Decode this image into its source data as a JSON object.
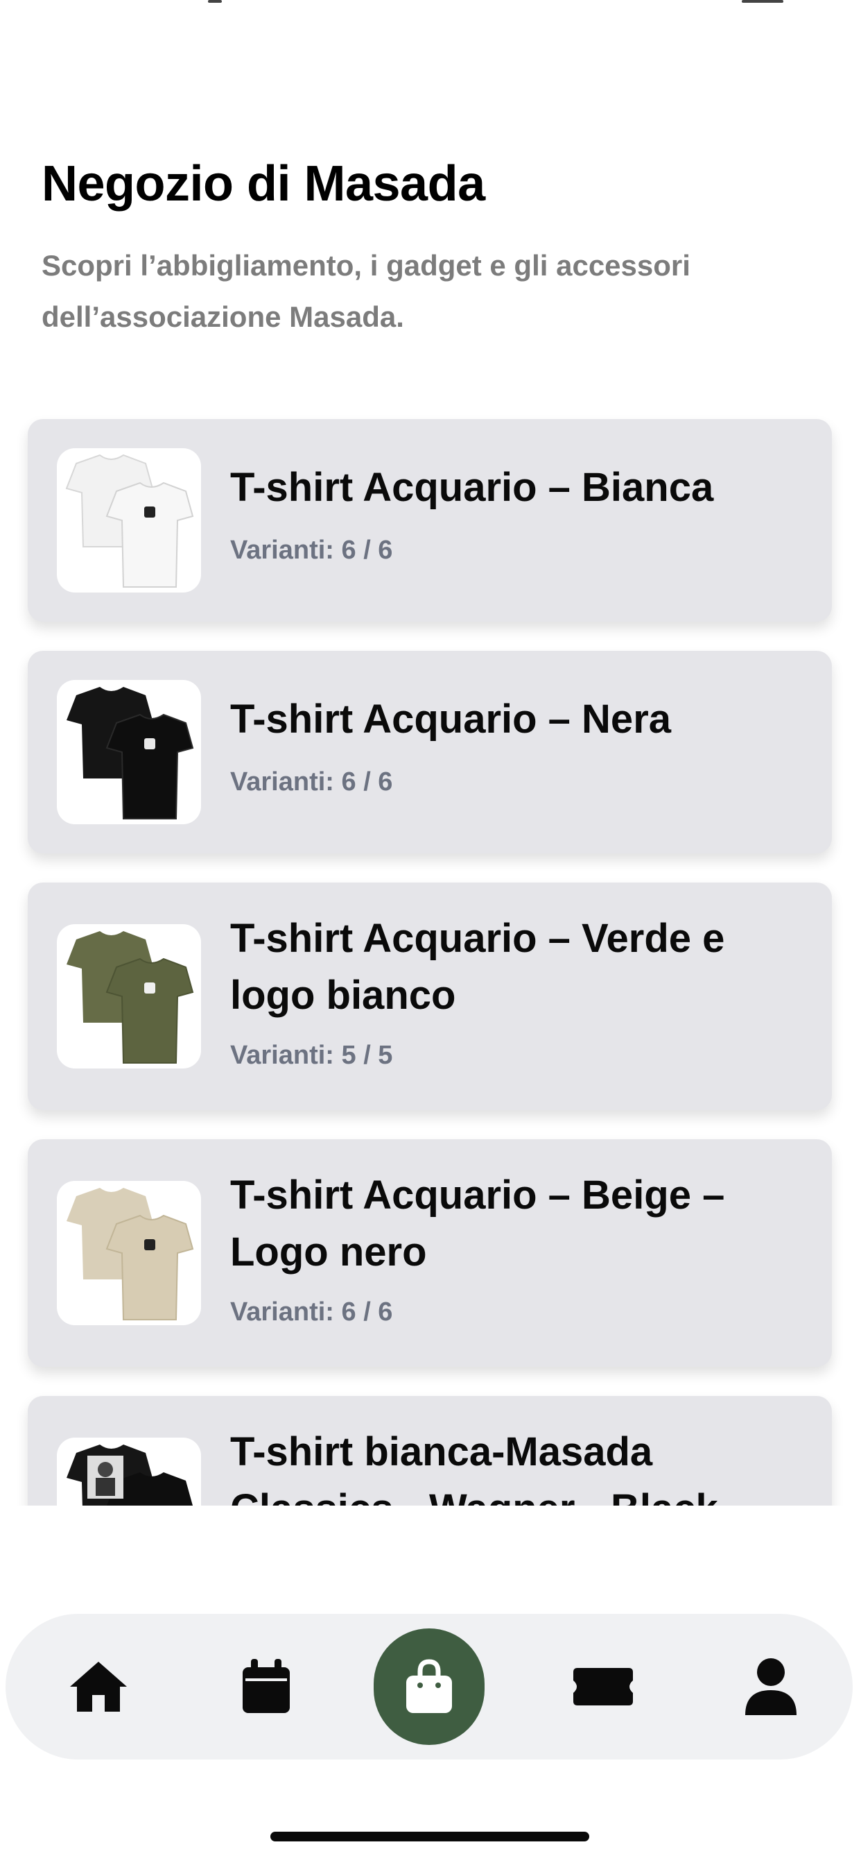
{
  "page": {
    "title": "Negozio di Masada",
    "subtitle": "Scopri l’abbigliamento, i gadget e gli accessori dell’associazione Masada."
  },
  "products": [
    {
      "name": "T-shirt Acquario – Bianca",
      "variants": "Varianti: 6 / 6",
      "shirt_color": "#f7f7f7",
      "logo_color": "#222222",
      "thumb_icon": "white-tshirt-thumbnail"
    },
    {
      "name": "T-shirt Acquario – Nera",
      "variants": "Varianti: 6 / 6",
      "shirt_color": "#111111",
      "logo_color": "#e9e9e9",
      "thumb_icon": "black-tshirt-thumbnail"
    },
    {
      "name": "T-shirt Acquario – Verde e logo bianco",
      "variants": "Varianti: 5 / 5",
      "shirt_color": "#5d6440",
      "logo_color": "#f0f0f0",
      "thumb_icon": "green-tshirt-thumbnail"
    },
    {
      "name": "T-shirt Acquario – Beige – Logo nero",
      "variants": "Varianti: 6 / 6",
      "shirt_color": "#d7ccb3",
      "logo_color": "#222222",
      "thumb_icon": "beige-tshirt-thumbnail"
    },
    {
      "name": "T-shirt bianca-Masada Classics - Wagner - Black",
      "variants": "",
      "shirt_color": "#111111",
      "logo_color": "#dddddd",
      "thumb_icon": "black-tshirt-print-thumbnail"
    }
  ],
  "tabbar": {
    "items": [
      {
        "icon": "home-icon",
        "active": false
      },
      {
        "icon": "calendar-icon",
        "active": false
      },
      {
        "icon": "shopping-bag-icon",
        "active": true
      },
      {
        "icon": "ticket-icon",
        "active": false
      },
      {
        "icon": "profile-icon",
        "active": false
      }
    ],
    "active_color": "#3f5d41"
  }
}
